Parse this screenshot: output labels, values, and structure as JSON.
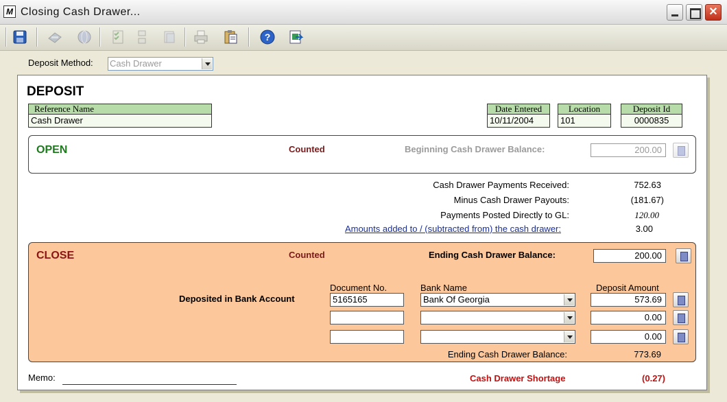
{
  "window": {
    "title": "Closing Cash Drawer...",
    "app_icon": "M"
  },
  "toolbar": {
    "icons": [
      "save-icon",
      "print-preview-icon",
      "globe-icon",
      "checklist-icon",
      "grid-icon",
      "copy-icon",
      "printer-icon",
      "clipboard-icon",
      "help-icon",
      "export-icon"
    ]
  },
  "deposit_method": {
    "label": "Deposit Method:",
    "value": "Cash Drawer"
  },
  "deposit": {
    "title": "DEPOSIT",
    "reference_name_label": "Reference Name",
    "reference_name": "Cash Drawer",
    "date_entered_label": "Date Entered",
    "date_entered": "10/11/2004",
    "location_label": "Location",
    "location": "101",
    "deposit_id_label": "Deposit Id",
    "deposit_id": "0000835"
  },
  "open": {
    "label": "OPEN",
    "counted": "Counted",
    "beginning_balance_label": "Beginning Cash Drawer Balance:",
    "beginning_balance": "200.00"
  },
  "summary": {
    "payments_received_label": "Cash Drawer Payments Received:",
    "payments_received": "752.63",
    "payouts_label": "Minus Cash Drawer Payouts:",
    "payouts": "(181.67)",
    "posted_gl_label": "Payments Posted Directly to GL:",
    "posted_gl": "120.00",
    "amounts_added_label": "Amounts added to / (subtracted from) the cash drawer:",
    "amounts_added": "3.00"
  },
  "close": {
    "label": "CLOSE",
    "counted": "Counted",
    "ending_balance_label": "Ending Cash Drawer Balance:",
    "ending_balance": "200.00",
    "deposited_label": "Deposited in Bank Account",
    "document_no_header": "Document No.",
    "bank_name_header": "Bank Name",
    "deposit_amount_header": "Deposit Amount",
    "rows": [
      {
        "document_no": "5165165",
        "bank_name": "Bank Of Georgia",
        "amount": "573.69"
      },
      {
        "document_no": "",
        "bank_name": "",
        "amount": "0.00"
      },
      {
        "document_no": "",
        "bank_name": "",
        "amount": "0.00"
      }
    ],
    "ending_balance_bottom_label": "Ending Cash Drawer Balance:",
    "ending_balance_bottom": "773.69"
  },
  "memo": {
    "label": "Memo:",
    "value": ""
  },
  "shortage": {
    "label": "Cash Drawer Shortage",
    "value": "(0.27)"
  }
}
